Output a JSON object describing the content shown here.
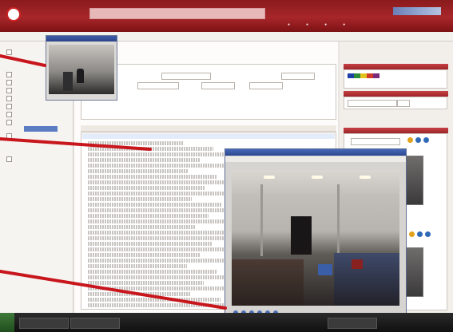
{
  "header": {
    "logo_text": "",
    "search_text": "",
    "user_nav": [
      "",
      "",
      "",
      ""
    ]
  },
  "toolbar": {
    "items": [
      "",
      "",
      "",
      ""
    ]
  },
  "sidebar": {
    "items": [
      {
        "label": ""
      },
      {
        "label": ""
      },
      {
        "label": ""
      },
      {
        "label": ""
      },
      {
        "label": ""
      },
      {
        "label": ""
      },
      {
        "label": ""
      },
      {
        "label": ""
      },
      {
        "label": ""
      },
      {
        "label": ""
      },
      {
        "label": ""
      }
    ]
  },
  "log_tabs": [
    "",
    "",
    "",
    "",
    ""
  ],
  "right_panels": {
    "heads": [
      "",
      "",
      ""
    ],
    "legend_colors": [
      "#1f3fa8",
      "#2e8b3a",
      "#e2c21c",
      "#d23a2a",
      "#7b2a7b",
      "#999999"
    ],
    "select_value": ""
  },
  "popups": {
    "small_title": "",
    "large_title": ""
  },
  "colors": {
    "brand_red": "#a8262a",
    "callout_red": "#c8161d",
    "window_blue": "#2c4690",
    "selected_blue": "#5b7bc2"
  },
  "icons": [
    "logo-icon",
    "search-icon",
    "user-icon",
    "settings-icon",
    "help-icon",
    "logout-icon",
    "folder-icon",
    "camera-icon",
    "play-icon",
    "stop-icon",
    "zoom-icon",
    "snapshot-icon",
    "windows-start-icon"
  ]
}
